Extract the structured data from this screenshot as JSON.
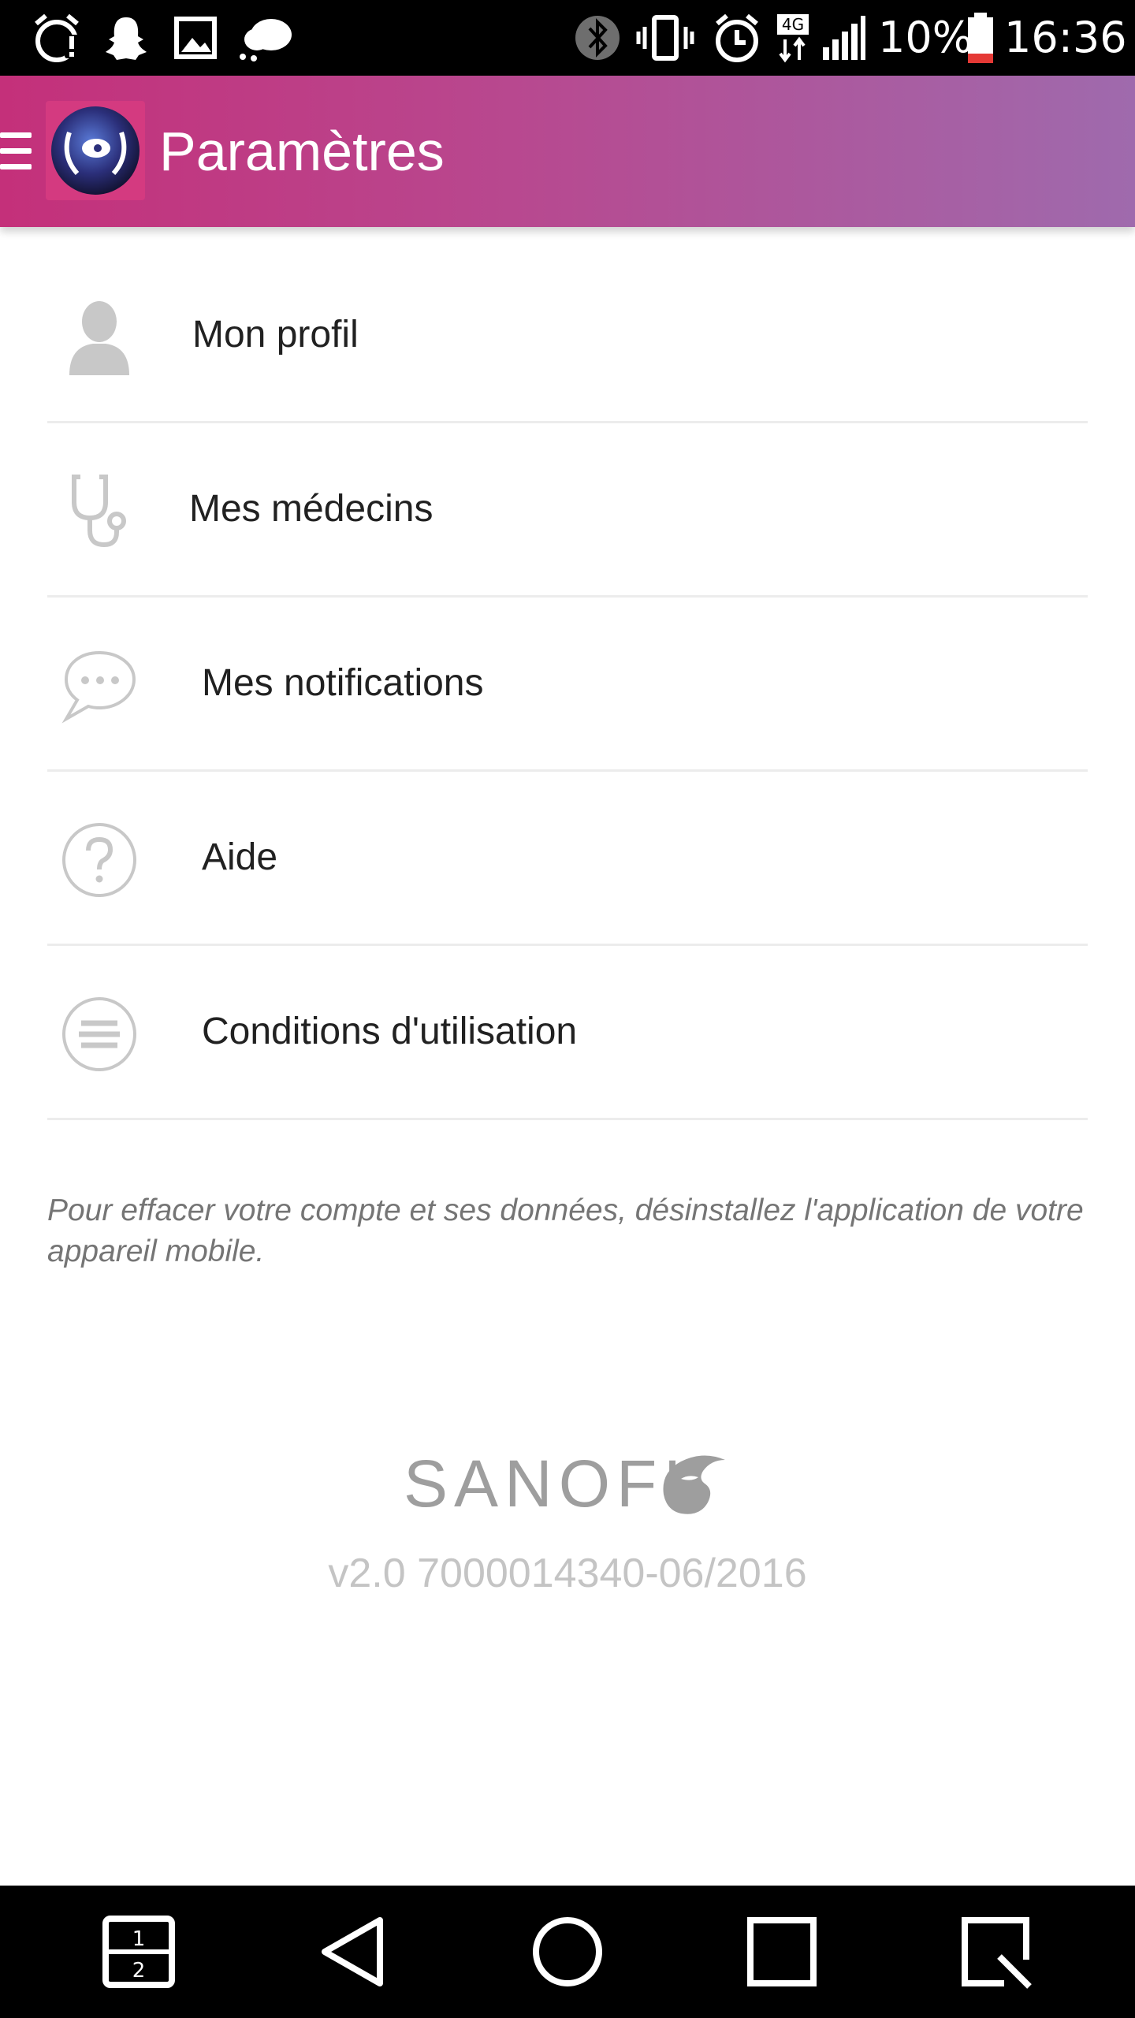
{
  "status_bar": {
    "battery_percent": "10%",
    "time": "16:36",
    "network": "4G",
    "icons": [
      "alarm-icon",
      "snapchat-icon",
      "gallery-icon",
      "cloud-icon",
      "bluetooth-icon",
      "vibrate-icon",
      "alarm-clock-icon",
      "signal-icon",
      "battery-icon"
    ]
  },
  "app_bar": {
    "title": "Paramètres",
    "menu_icon": "hamburger-menu-icon",
    "logo_icon": "app-logo-icon"
  },
  "settings": {
    "items": [
      {
        "label": "Mon profil",
        "icon": "profile-icon"
      },
      {
        "label": "Mes médecins",
        "icon": "stethoscope-icon"
      },
      {
        "label": "Mes notifications",
        "icon": "chat-bubble-icon"
      },
      {
        "label": "Aide",
        "icon": "help-icon"
      },
      {
        "label": "Conditions d'utilisation",
        "icon": "document-list-icon"
      }
    ]
  },
  "footer": {
    "note": "Pour effacer votre compte et ses données, désinstallez l'application de votre appareil mobile.",
    "brand": "SANOFI",
    "version": "v2.0  7000014340-06/2016"
  },
  "nav_bar": {
    "buttons": [
      "dual-window-icon",
      "back-icon",
      "home-icon",
      "recents-icon",
      "capture-icon"
    ]
  },
  "colors": {
    "app_bar_start": "#c4307a",
    "app_bar_end": "#9f6aad",
    "divider": "#ececec",
    "icon_gray": "#c8c8c8"
  }
}
